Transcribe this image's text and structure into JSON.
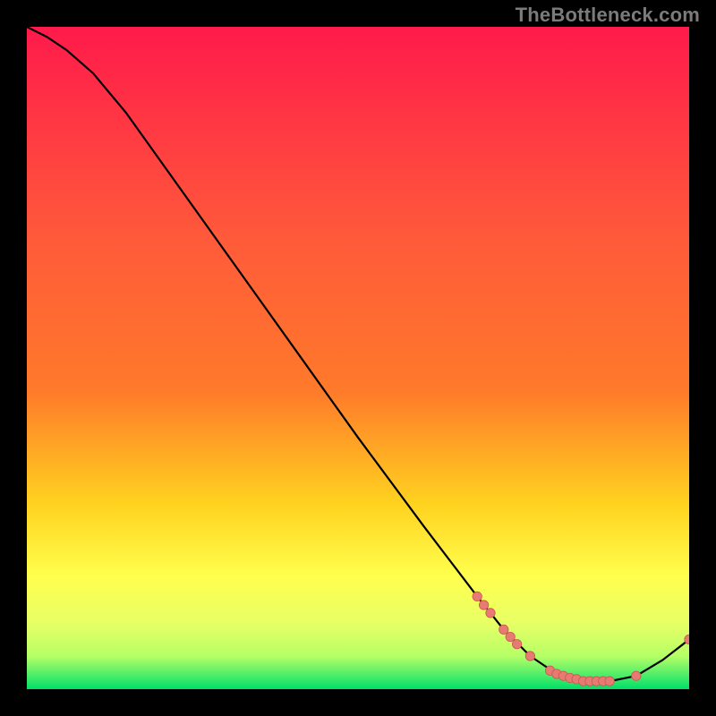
{
  "watermark": "TheBottleneck.com",
  "colors": {
    "background": "#000000",
    "gradient_top": "#ff1a4b",
    "gradient_mid1": "#ff7a2a",
    "gradient_mid2": "#ffd21f",
    "gradient_mid3": "#ffff4d",
    "gradient_bottom": "#00e06a",
    "curve": "#000000",
    "marker_fill": "#e77a72",
    "marker_stroke": "#c9584f"
  },
  "chart_data": {
    "type": "line",
    "title": "",
    "xlabel": "",
    "ylabel": "",
    "xlim": [
      0,
      100
    ],
    "ylim": [
      0,
      100
    ],
    "grid": false,
    "curve": [
      {
        "x": 0,
        "y": 100
      },
      {
        "x": 3,
        "y": 98.5
      },
      {
        "x": 6,
        "y": 96.5
      },
      {
        "x": 10,
        "y": 93
      },
      {
        "x": 15,
        "y": 87
      },
      {
        "x": 20,
        "y": 80
      },
      {
        "x": 30,
        "y": 66
      },
      {
        "x": 40,
        "y": 52
      },
      {
        "x": 50,
        "y": 38
      },
      {
        "x": 60,
        "y": 24.5
      },
      {
        "x": 68,
        "y": 14
      },
      {
        "x": 72,
        "y": 9
      },
      {
        "x": 76,
        "y": 5
      },
      {
        "x": 80,
        "y": 2.3
      },
      {
        "x": 84,
        "y": 1.2
      },
      {
        "x": 88,
        "y": 1.2
      },
      {
        "x": 92,
        "y": 2
      },
      {
        "x": 96,
        "y": 4.4
      },
      {
        "x": 100,
        "y": 7.5
      }
    ],
    "markers": [
      {
        "x": 68,
        "y": 14
      },
      {
        "x": 69,
        "y": 12.7
      },
      {
        "x": 70,
        "y": 11.5
      },
      {
        "x": 72,
        "y": 9
      },
      {
        "x": 73,
        "y": 7.9
      },
      {
        "x": 74,
        "y": 6.8
      },
      {
        "x": 76,
        "y": 5
      },
      {
        "x": 79,
        "y": 2.8
      },
      {
        "x": 80,
        "y": 2.3
      },
      {
        "x": 81,
        "y": 2.0
      },
      {
        "x": 82,
        "y": 1.7
      },
      {
        "x": 83,
        "y": 1.5
      },
      {
        "x": 84,
        "y": 1.2
      },
      {
        "x": 85,
        "y": 1.2
      },
      {
        "x": 86,
        "y": 1.2
      },
      {
        "x": 87,
        "y": 1.2
      },
      {
        "x": 88,
        "y": 1.2
      },
      {
        "x": 92,
        "y": 2
      },
      {
        "x": 100,
        "y": 7.5
      }
    ]
  }
}
